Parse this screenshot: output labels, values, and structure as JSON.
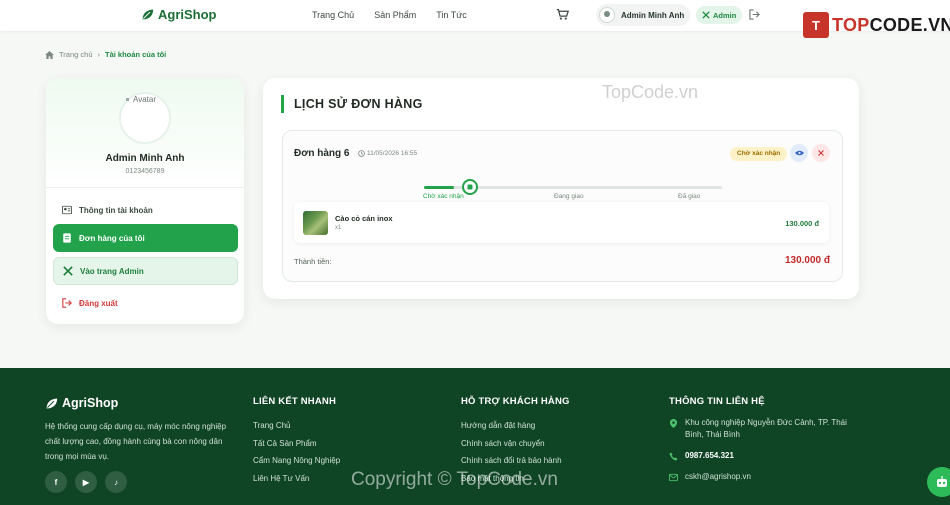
{
  "header": {
    "brand": "AgriShop",
    "nav": [
      "Trang Chủ",
      "Sản Phẩm",
      "Tin Tức"
    ],
    "user_name": "Admin Minh Anh",
    "admin_badge": "Admin",
    "watermark_logo": {
      "prefix": "T",
      "highlight": "TOP",
      "rest": "CODE.VN"
    }
  },
  "breadcrumb": {
    "home": "Trang chủ",
    "separator": "›",
    "current": "Tài khoản của tôi"
  },
  "sidebar": {
    "avatar_alt": "Avatar",
    "name": "Admin Minh Anh",
    "phone": "0123456789",
    "items": [
      {
        "label": "Thông tin tài khoản",
        "icon": "id-card-icon"
      },
      {
        "label": "Đơn hàng của tôi",
        "icon": "receipt-icon"
      },
      {
        "label": "Vào trang Admin",
        "icon": "tools-icon"
      },
      {
        "label": "Đăng xuất",
        "icon": "logout-icon"
      }
    ]
  },
  "orders": {
    "title": "LỊCH SỬ ĐƠN HÀNG",
    "order": {
      "id_label": "Đơn hàng 6",
      "date": "11/05/2026 16:55",
      "status": "Chờ xác nhận",
      "progress": 0.1,
      "steps": [
        "Chờ xác nhận",
        "Đang giao",
        "Đã giao"
      ],
      "item": {
        "name": "Cào cỏ cán inox",
        "qty": "x1",
        "price": "130.000 đ"
      },
      "total_label": "Thành tiền:",
      "total_value": "130.000 đ"
    }
  },
  "footer": {
    "brand": "AgriShop",
    "description": "Hệ thống cung cấp dụng cụ, máy móc nông nghiệp chất lượng cao, đồng hành cùng bà con nông dân trong mọi mùa vụ.",
    "socials": [
      "f",
      "▶",
      "♪"
    ],
    "quick_links": {
      "title": "LIÊN KẾT NHANH",
      "items": [
        "Trang Chủ",
        "Tất Cả Sản Phẩm",
        "Cẩm Nang Nông Nghiệp",
        "Liên Hệ Tư Vấn"
      ]
    },
    "support": {
      "title": "HỖ TRỢ KHÁCH HÀNG",
      "items": [
        "Hướng dẫn đặt hàng",
        "Chính sách vận chuyển",
        "Chính sách đổi trả bảo hành",
        "Bảo mật thông tin"
      ]
    },
    "contact": {
      "title": "THÔNG TIN LIÊN HỆ",
      "address": "Khu công nghiệp Nguyễn Đức Cảnh, TP. Thái Bình, Thái Bình",
      "phone": "0987.654.321",
      "email": "cskh@agrishop.vn"
    }
  },
  "watermarks": {
    "top": "TopCode.vn",
    "bottom": "Copyright © TopCode.vn"
  },
  "colors": {
    "primary": "#22a24a",
    "footer": "#0f4425",
    "price": "#c32a2a"
  }
}
